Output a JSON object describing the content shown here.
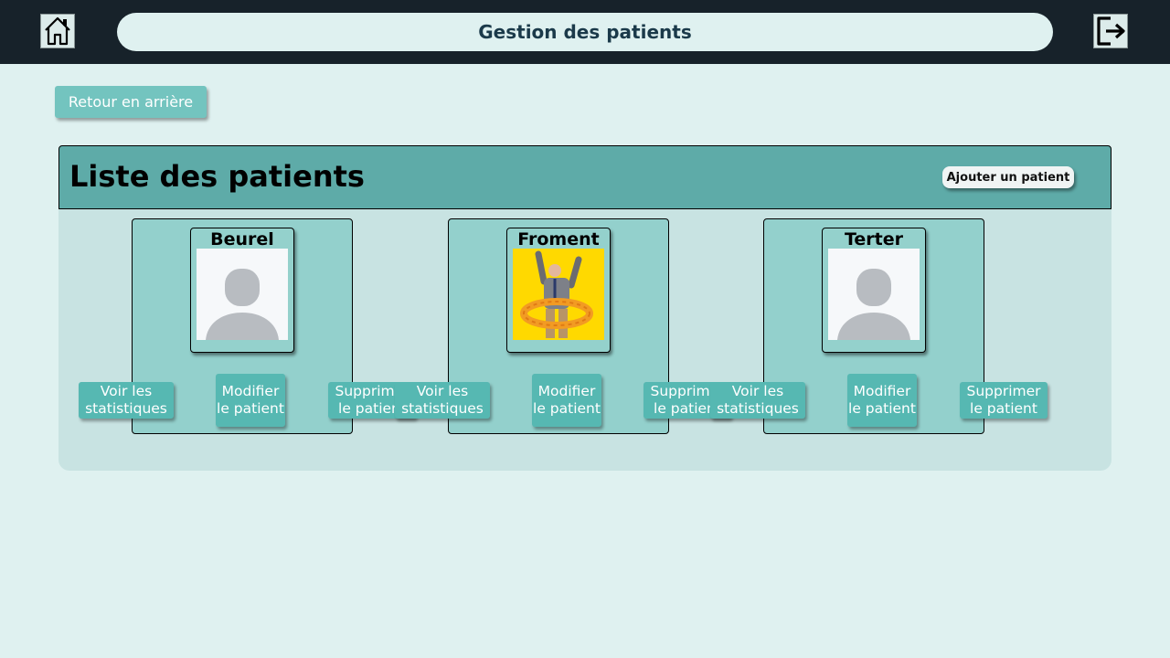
{
  "header": {
    "title": "Gestion des patients",
    "home_icon": "home-icon",
    "logout_icon": "logout-icon"
  },
  "back_button": "Retour en arrière",
  "list": {
    "title": "Liste des patients",
    "add_button": "Ajouter un patient"
  },
  "patients": [
    {
      "name": "Beurel",
      "photo": "default-avatar",
      "stats_label": "Voir les statistiques",
      "edit_label": "Modifier le patient",
      "delete_label": "Supprimer le patient"
    },
    {
      "name": "Froment",
      "photo": "elderly-man-with-swim-ring-photo",
      "stats_label": "Voir les statistiques",
      "edit_label": "Modifier le patient",
      "delete_label": "Supprimer le patient"
    },
    {
      "name": "Terter",
      "photo": "default-avatar",
      "stats_label": "Voir les statistiques",
      "edit_label": "Modifier le patient",
      "delete_label": "Supprimer le patient"
    }
  ],
  "colors": {
    "topbar": "#17222a",
    "background": "#dff1f0",
    "header_teal": "#5eaba8",
    "card_teal": "#93d0cc",
    "button_teal": "#56b8b2"
  }
}
